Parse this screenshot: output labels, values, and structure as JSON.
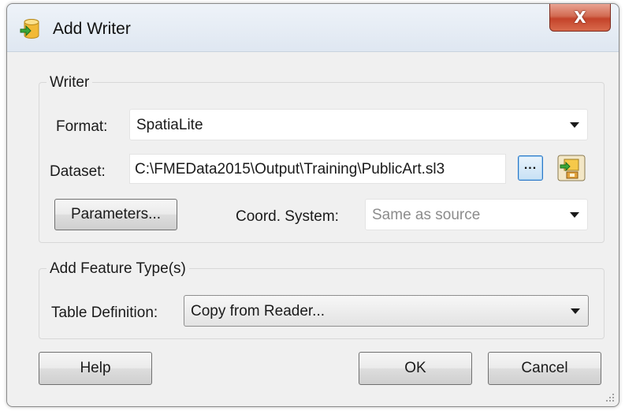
{
  "window": {
    "title": "Add Writer",
    "close_label": "X"
  },
  "writer_group": {
    "label": "Writer",
    "format_label": "Format:",
    "format_value": "SpatiaLite",
    "dataset_label": "Dataset:",
    "dataset_value": "C:\\FMEData2015\\Output\\Training\\PublicArt.sl3",
    "browse_label": "...",
    "parameters_label": "Parameters...",
    "coord_label": "Coord. System:",
    "coord_value": "Same as source"
  },
  "feature_group": {
    "label": "Add Feature Type(s)",
    "table_def_label": "Table Definition:",
    "table_def_value": "Copy from Reader..."
  },
  "buttons": {
    "help": "Help",
    "ok": "OK",
    "cancel": "Cancel"
  },
  "icons": {
    "app": "database-add-icon",
    "settings": "writer-settings-icon",
    "close": "close-icon",
    "grip": "resize-grip-icon"
  }
}
